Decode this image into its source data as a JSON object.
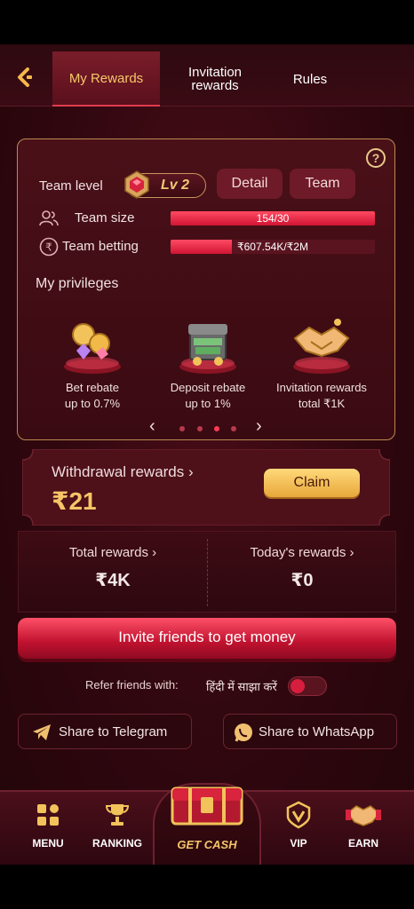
{
  "tabs": [
    {
      "label": "My Rewards"
    },
    {
      "label": "Invitation\nrewards"
    },
    {
      "label": "Rules"
    }
  ],
  "team": {
    "team_level_label": "Team level",
    "level": "Lv 2",
    "detail_label": "Detail",
    "team_label": "Team",
    "team_size_label": "Team size",
    "team_size_value": "154/30",
    "team_size_progress": 1.0,
    "team_betting_label": "Team betting",
    "team_betting_value": "₹607.54K/₹2M",
    "team_betting_progress": 0.3,
    "help_icon": "?"
  },
  "privileges": {
    "title": "My privileges",
    "items": [
      {
        "line1": "Bet rebate",
        "line2": "up to 0.7%"
      },
      {
        "line1": "Deposit rebate",
        "line2": "up to 1%"
      },
      {
        "line1": "Invitation rewards",
        "line2": "total ₹1K"
      }
    ],
    "prev": "‹",
    "next": "›"
  },
  "withdrawal": {
    "title": "Withdrawal rewards ›",
    "amount": "₹21",
    "claim_label": "Claim"
  },
  "totals": {
    "total_label": "Total rewards ›",
    "total_value": "₹4K",
    "today_label": "Today's rewards ›",
    "today_value": "₹0"
  },
  "invite_label": "Invite friends to get money",
  "refer": {
    "label": "Refer friends with:",
    "lang_label": "हिंदी में साझा करें"
  },
  "share": {
    "telegram": "Share to Telegram",
    "whatsapp": "Share to WhatsApp"
  },
  "nav": {
    "menu": "MENU",
    "ranking": "RANKING",
    "get_cash": "GET CASH",
    "vip": "VIP",
    "earn": "EARN"
  },
  "colors": {
    "accent_gold": "#f5c86a",
    "accent_red": "#d01434",
    "background": "#30070f"
  }
}
